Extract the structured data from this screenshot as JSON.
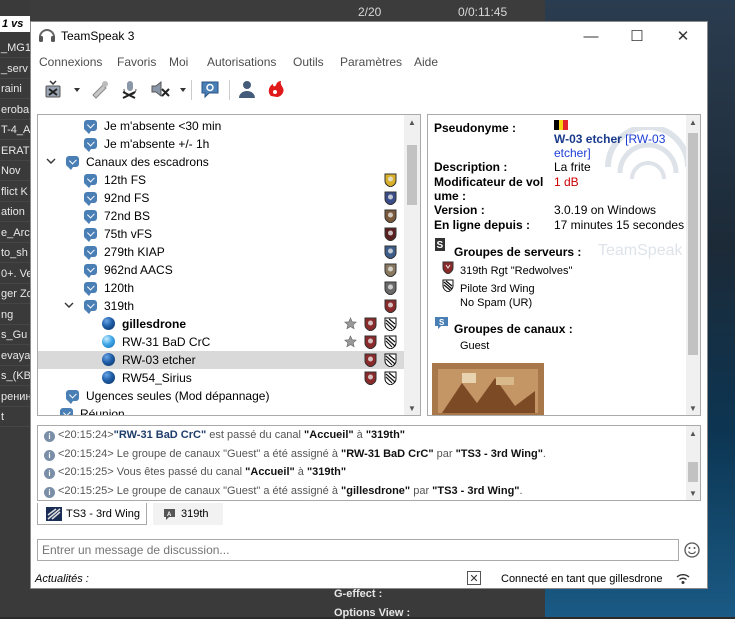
{
  "background": {
    "vs_tag": "1 vs",
    "left_strip": [
      "_MG1",
      "_serv",
      "raini",
      "eroba",
      "T-4_A",
      "ERATI",
      "Nov",
      "flict K",
      "ation",
      "e_Arc",
      "to_sh",
      "0+. Ve",
      "ger Zo",
      "ng",
      "s_Gu",
      "evaya",
      "s_(KB",
      "ренин",
      "t"
    ],
    "top": {
      "count": "2/20",
      "time": "0/0:11:45"
    },
    "bottom": {
      "line1": "G-effect :",
      "line2": "Options View :"
    }
  },
  "window": {
    "title": "TeamSpeak 3",
    "minimize": "—",
    "maximize": "☐",
    "close": "✕"
  },
  "menu": [
    "Connexions",
    "Favoris",
    "Moi",
    "Autorisations",
    "Outils",
    "Paramètres",
    "Aide"
  ],
  "toolbar": {
    "icons": [
      "disconnect-icon",
      "away-icon",
      "mute-mic-icon",
      "mute-speakers-icon",
      "chat-icon",
      "contacts-icon",
      "channel-commander-icon"
    ]
  },
  "tree": {
    "rows": [
      {
        "type": "channel",
        "label": "Je m'absente <30 min"
      },
      {
        "type": "channel",
        "label": "Je m'absente +/- 1h"
      },
      {
        "type": "channel",
        "label": "Canaux des escadrons",
        "expanded": true
      },
      {
        "type": "channel",
        "label": "12th FS"
      },
      {
        "type": "channel",
        "label": "92nd FS"
      },
      {
        "type": "channel",
        "label": "72nd BS"
      },
      {
        "type": "channel",
        "label": "75th vFS"
      },
      {
        "type": "channel",
        "label": "279th KIAP"
      },
      {
        "type": "channel",
        "label": "962nd AACS"
      },
      {
        "type": "channel",
        "label": "120th"
      },
      {
        "type": "channel",
        "label": "319th",
        "expanded": true
      },
      {
        "type": "user",
        "label": "gillesdrone"
      },
      {
        "type": "user",
        "label": "RW-31 BaD CrC"
      },
      {
        "type": "user",
        "label": "RW-03 etcher"
      },
      {
        "type": "user",
        "label": "RW54_Sirius"
      },
      {
        "type": "channel",
        "label": "Ugences seules (Mod dépannage)"
      },
      {
        "type": "channel",
        "label": "Réunion"
      }
    ]
  },
  "info": {
    "nick_label": "Pseudonyme :",
    "nick_value": "W-03 etcher",
    "nick_extra": "[RW-03",
    "nick_extra2": "etcher]",
    "desc_label": "Description :",
    "desc_value": "La frite",
    "volmod_label_a": "Modificateur de vol",
    "volmod_label_b": "ume :",
    "volmod_value": "1 dB",
    "version_label": "Version :",
    "version_value": "3.0.19 on Windows",
    "online_label": "En ligne depuis :",
    "online_value": "17 minutes 15 secondes",
    "server_groups_title": "Groupes de serveurs :",
    "server_groups": [
      "319th Rgt \"Redwolves\"",
      "Pilote 3rd Wing",
      "No Spam (UR)"
    ],
    "channel_groups_title": "Groupes de canaux :",
    "channel_groups": [
      "Guest"
    ],
    "watermark": "TeamSpeak 3"
  },
  "log": [
    {
      "time": "<20:15:24>",
      "who": "\"RW-31 BaD CrC\"",
      "text1": " est passé du canal ",
      "from": "\"Accueil\"",
      "text2": " à ",
      "to": "\"319th\"",
      "text3": "",
      "by": ""
    },
    {
      "time": "<20:15:24>",
      "who": "",
      "text1": " Le groupe de canaux \"Guest\"  a été assigné à ",
      "from": "\"RW-31 BaD CrC\"",
      "text2": " par ",
      "to": "\"TS3 - 3rd Wing\"",
      "text3": ".",
      "by": ""
    },
    {
      "time": "<20:15:25>",
      "who": "",
      "text1": " Vous êtes passé du canal ",
      "from": "\"Accueil\"",
      "text2": " à ",
      "to": "\"319th\"",
      "text3": "",
      "by": ""
    },
    {
      "time": "<20:15:25>",
      "who": "",
      "text1": " Le groupe de canaux \"Guest\"  a été assigné à ",
      "from": "\"gillesdrone\"",
      "text2": " par ",
      "to": "\"TS3 - 3rd Wing\"",
      "text3": ".",
      "by": ""
    }
  ],
  "tabs": [
    {
      "label": "TS3 - 3rd Wing",
      "active": true
    },
    {
      "label": "319th",
      "active": false
    }
  ],
  "chat": {
    "placeholder": "Entrer un message de discussion..."
  },
  "status": {
    "news_label": "Actualités :",
    "connected": "Connecté en tant que gillesdrone"
  },
  "colors": {
    "accent_blue": "#1a3a8a",
    "nick_red": "#cc0000",
    "link_blue": "#1e3dd6"
  }
}
